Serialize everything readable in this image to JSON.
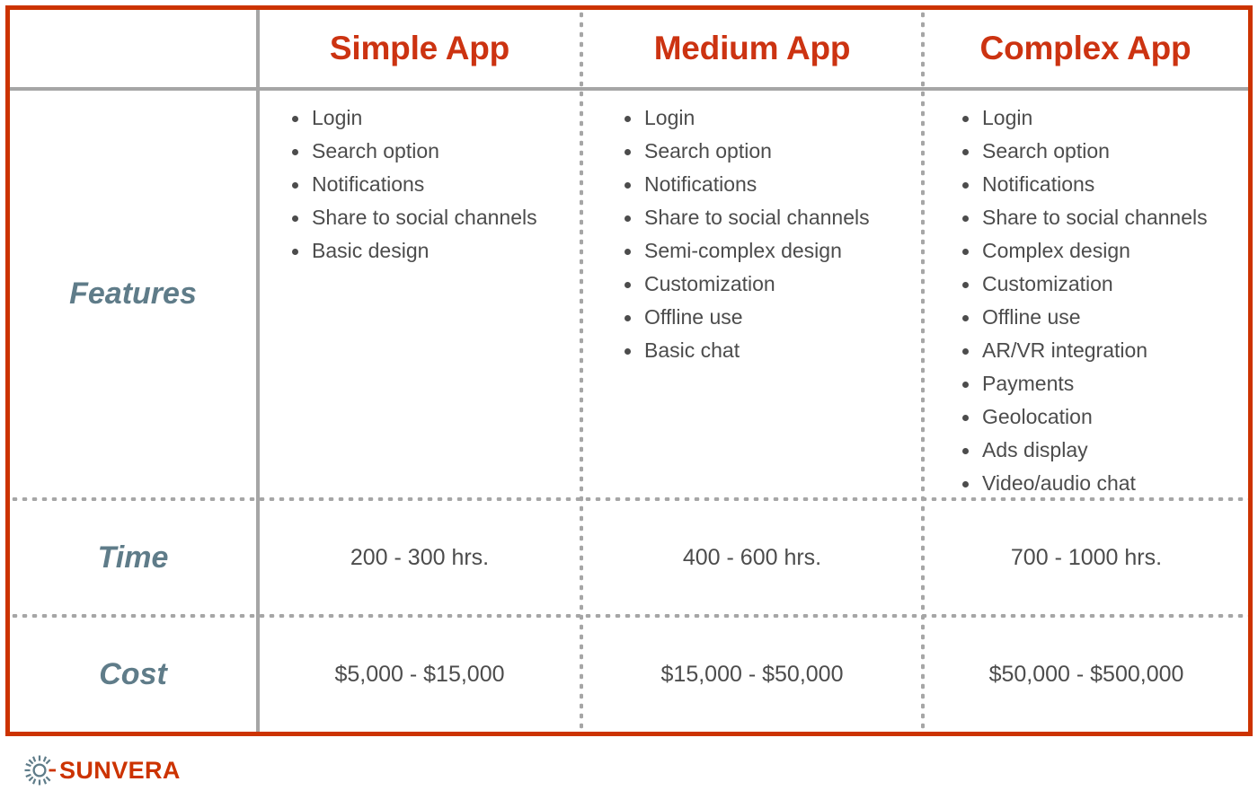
{
  "table": {
    "columns": [
      {
        "key": "label",
        "header": ""
      },
      {
        "key": "simple",
        "header": "Simple App"
      },
      {
        "key": "medium",
        "header": "Medium App"
      },
      {
        "key": "complex",
        "header": "Complex App"
      }
    ],
    "rows": {
      "features": {
        "label": "Features",
        "simple": [
          "Login",
          "Search option",
          "Notifications",
          "Share to social channels",
          "Basic design"
        ],
        "medium": [
          "Login",
          "Search option",
          "Notifications",
          "Share to social channels",
          "Semi-complex design",
          "Customization",
          "Offline use",
          "Basic chat"
        ],
        "complex": [
          "Login",
          "Search option",
          "Notifications",
          "Share to social channels",
          "Complex design",
          "Customization",
          "Offline use",
          "AR/VR integration",
          "Payments",
          "Geolocation",
          "Ads display",
          "Video/audio chat"
        ]
      },
      "time": {
        "label": "Time",
        "simple": "200 - 300 hrs.",
        "medium": "400 - 600 hrs.",
        "complex": "700 - 1000 hrs."
      },
      "cost": {
        "label": "Cost",
        "simple": "$5,000 - $15,000",
        "medium": "$15,000 - $50,000",
        "complex": "$50,000 - $500,000"
      }
    }
  },
  "footer": {
    "brand": "SUNVERA",
    "logo_icon": "sun-icon"
  },
  "colors": {
    "border_accent": "#cc3300",
    "header_text": "#cc3311",
    "row_label_text": "#5f7c89",
    "body_text": "#4c4c4c",
    "grid_line": "#a6a6a6",
    "background": "#ffffff"
  }
}
